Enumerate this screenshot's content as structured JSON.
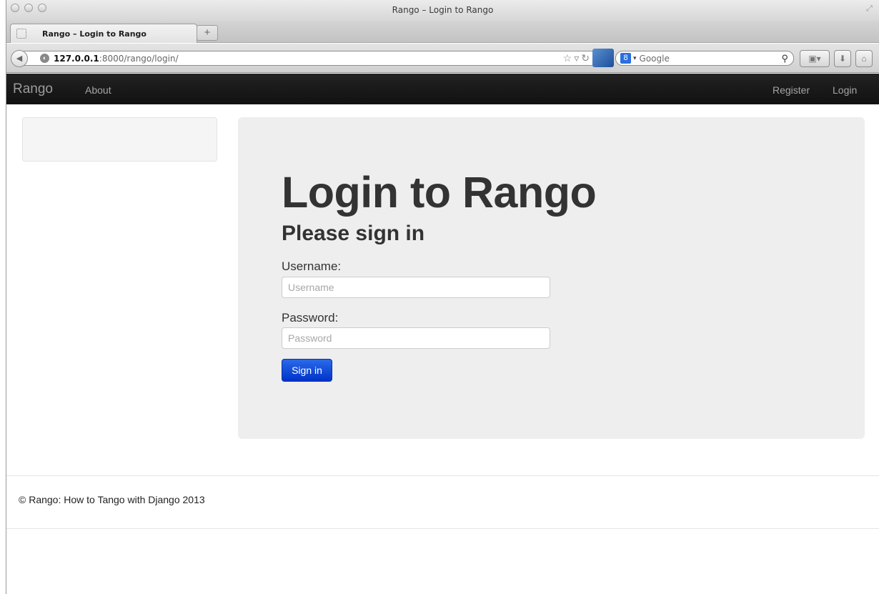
{
  "window": {
    "title": "Rango – Login to Rango"
  },
  "tab": {
    "title": "Rango – Login to Rango",
    "new_tab_symbol": "+"
  },
  "browser_toolbar": {
    "url_host": "127.0.0.1",
    "url_rest": ":8000/rango/login/",
    "search_placeholder": "Google",
    "search_engine_symbol": "8"
  },
  "site_nav": {
    "brand": "Rango",
    "links": [
      "About"
    ],
    "right_links": [
      "Register",
      "Login"
    ]
  },
  "hero": {
    "heading": "Login to Rango",
    "subheading": "Please sign in",
    "username_label": "Username:",
    "username_placeholder": "Username",
    "password_label": "Password:",
    "password_placeholder": "Password",
    "submit_label": "Sign in"
  },
  "footer": {
    "text": "© Rango: How to Tango with Django 2013"
  },
  "colors": {
    "navbar": "#1a1a1a",
    "hero_bg": "#eeeeee",
    "button": "#0a44d8"
  },
  "icons": [
    "back-arrow-icon",
    "globe-icon",
    "bookmark-star-icon",
    "reload-icon",
    "google-icon",
    "magnify-icon",
    "download-icon",
    "home-icon"
  ]
}
